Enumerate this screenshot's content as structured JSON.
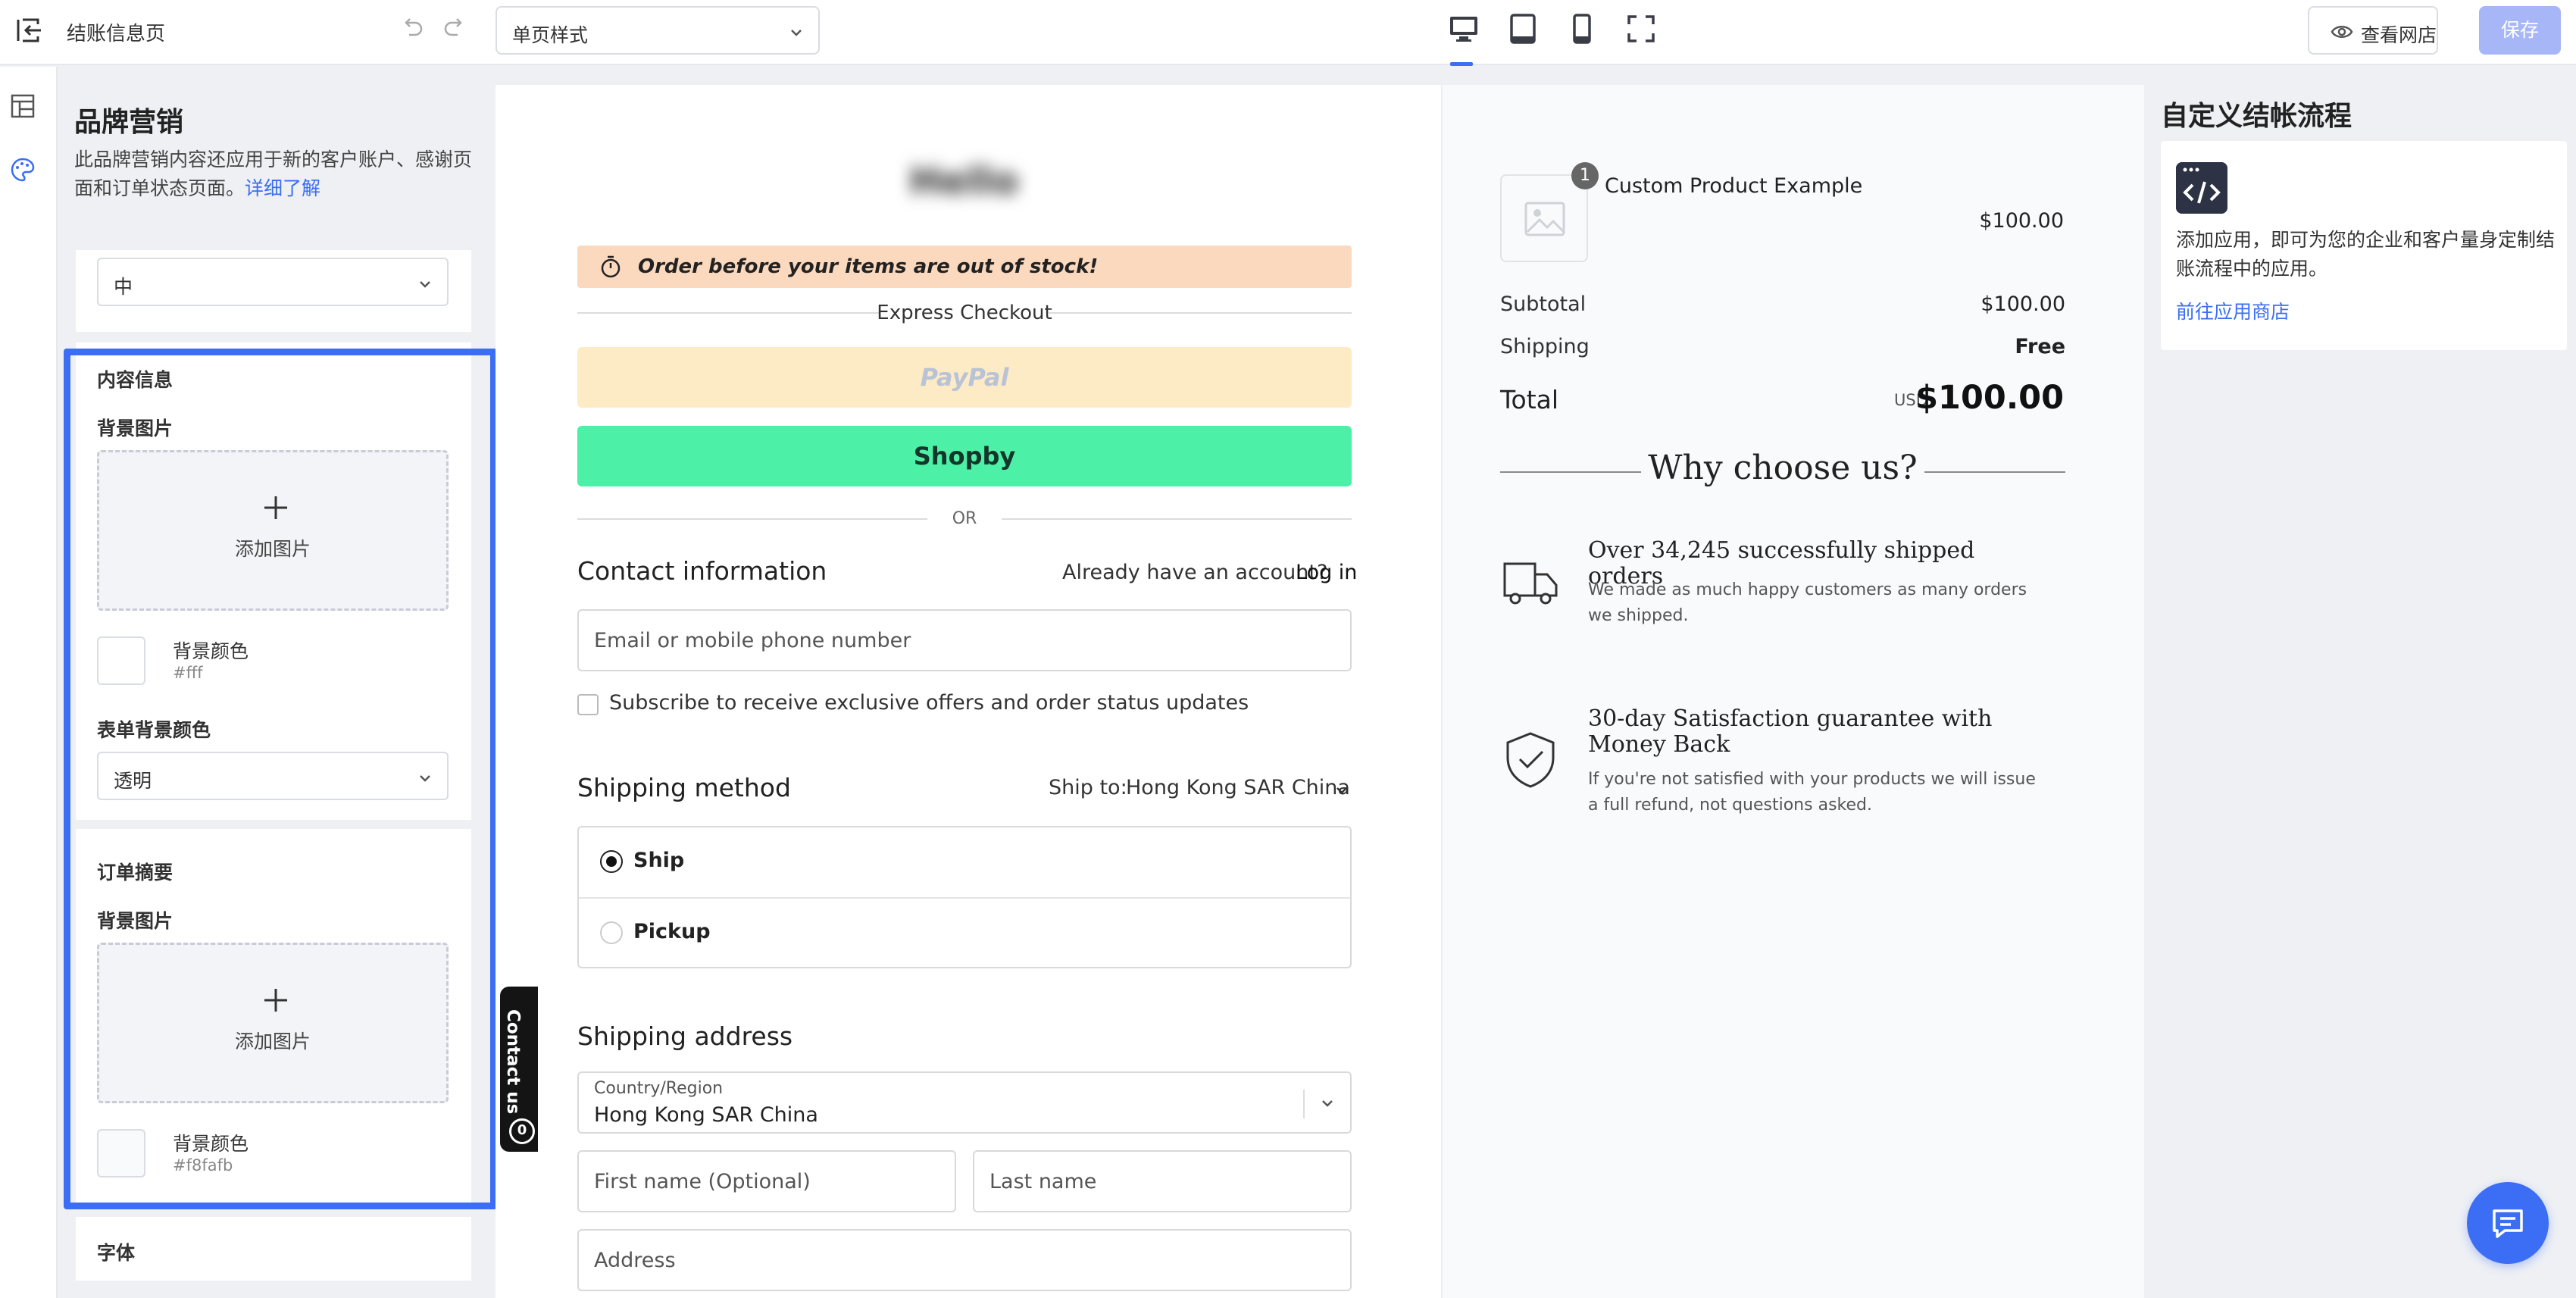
{
  "topbar": {
    "title": "结账信息页",
    "style_select": "单页样式",
    "view_store": "查看网店",
    "save": "保存",
    "devices": [
      "desktop-icon",
      "tablet-icon",
      "mobile-icon",
      "fullscreen-icon"
    ]
  },
  "panel": {
    "heading": "品牌营销",
    "desc": "此品牌营销内容还应用于新的客户账户、感谢页面和订单状态页面。",
    "learn_more": "详细了解",
    "size_select": "中",
    "content": {
      "title": "内容信息",
      "bg_image_label": "背景图片",
      "add_image": "添加图片",
      "bg_color_label": "背景颜色",
      "bg_color_value": "#fff",
      "form_bg_label": "表单背景颜色",
      "form_bg_value": "透明"
    },
    "summary": {
      "title": "订单摘要",
      "bg_image_label": "背景图片",
      "add_image": "添加图片",
      "bg_color_label": "背景颜色",
      "bg_color_value": "#f8fafb"
    },
    "font_title": "字体"
  },
  "contact_tab": {
    "label": "Contact us",
    "badge": "0"
  },
  "checkout": {
    "logo": "Hello",
    "urgency": "Order before your items are out of stock!",
    "express": "Express Checkout",
    "paypal": "PayPal",
    "shopify": "Shopby",
    "or": "OR",
    "contact_heading": "Contact information",
    "have_account": "Already have an account?",
    "login": "Log in",
    "email_placeholder": "Email or mobile phone number",
    "subscribe": "Subscribe to receive exclusive offers and order status updates",
    "shipping_heading": "Shipping method",
    "ship_to_label": "Ship to:",
    "ship_to_value": "Hong Kong SAR China",
    "opt_ship": "Ship",
    "opt_pickup": "Pickup",
    "address_heading": "Shipping address",
    "country_label": "Country/Region",
    "country_value": "Hong Kong SAR China",
    "first_name": "First name (Optional)",
    "last_name": "Last name",
    "address": "Address"
  },
  "summary": {
    "qty": "1",
    "product_name": "Custom Product Example",
    "product_price": "$100.00",
    "subtotal_label": "Subtotal",
    "subtotal_value": "$100.00",
    "shipping_label": "Shipping",
    "shipping_value": "Free",
    "total_label": "Total",
    "currency": "USD",
    "total_value": "$100.00",
    "why": "Why choose us?",
    "f1_title": "Over 34,245 successfully shipped orders",
    "f1_text": "We made as much happy customers as many orders we shipped.",
    "f2_title": "30-day Satisfaction guarantee with Money Back",
    "f2_text": "If you're not satisfied with your products we will issue a full refund, not questions asked."
  },
  "apps": {
    "heading": "自定义结帐流程",
    "text": "添加应用，即可为您的企业和客户量身定制结账流程中的应用。",
    "link": "前往应用商店"
  },
  "colors": {
    "accent": "#3b6ef5",
    "save_disabled": "#a7b6f7",
    "urgency": "#fbd9bf",
    "shopify": "#4cf0a6",
    "paypal": "#fdebc6"
  }
}
